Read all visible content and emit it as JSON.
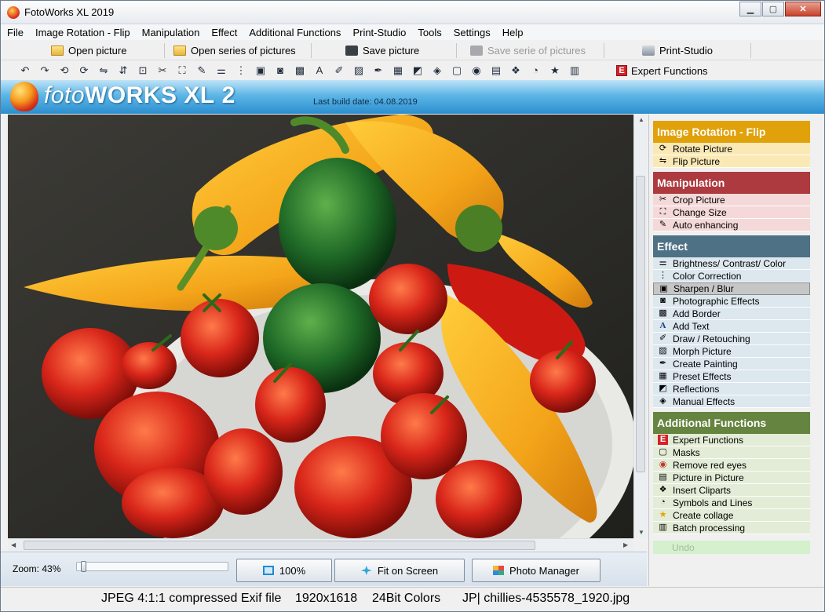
{
  "window": {
    "title": "FotoWorks XL 2019"
  },
  "menu": [
    "File",
    "Image Rotation - Flip",
    "Manipulation",
    "Effect",
    "Additional Functions",
    "Print-Studio",
    "Tools",
    "Settings",
    "Help"
  ],
  "toolbar": {
    "open_picture": "Open picture",
    "open_series": "Open series of pictures",
    "save_picture": "Save picture",
    "save_series": "Save serie of pictures",
    "print_studio": "Print-Studio",
    "expert_functions": "Expert Functions",
    "expert_icon_letter": "E"
  },
  "banner": {
    "logo_light": "foto",
    "logo_bold": "WORKS",
    "logo_xl": "XL",
    "logo_num": "2",
    "build": "Last build date: 04.08.2019"
  },
  "controls": {
    "zoom": "Zoom: 43%",
    "btn_100": "100%",
    "btn_fit": "Fit on Screen",
    "btn_pm": "Photo Manager",
    "zoom_fraction": 0.43
  },
  "sidebar": {
    "rotation": {
      "title": "Image Rotation - Flip",
      "items": [
        "Rotate Picture",
        "Flip Picture"
      ]
    },
    "manipulation": {
      "title": "Manipulation",
      "items": [
        "Crop Picture",
        "Change Size",
        "Auto enhancing"
      ]
    },
    "effect": {
      "title": "Effect",
      "items": [
        "Brightness/ Contrast/ Color",
        "Color Correction",
        "Sharpen / Blur",
        "Photographic Effects",
        "Add Border",
        "Add Text",
        "Draw / Retouching",
        "Morph Picture",
        "Create Painting",
        "Preset Effects",
        "Reflections",
        "Manual Effects"
      ]
    },
    "additional": {
      "title": "Additional Functions",
      "items": [
        "Expert Functions",
        "Masks",
        "Remove red eyes",
        "Picture in Picture",
        "Insert Cliparts",
        "Symbols and Lines",
        "Create collage",
        "Batch processing"
      ]
    },
    "undo": "Undo"
  },
  "status": {
    "format": "JPEG 4:1:1 compressed Exif file",
    "size": "1920x1618",
    "colors": "24Bit Colors",
    "file": "JP| chillies-4535578_1920.jpg"
  },
  "colors": {
    "rotation": "#e1a10a",
    "manipulation": "#ad3a3f",
    "effect": "#4f7185",
    "additional": "#64843f"
  }
}
